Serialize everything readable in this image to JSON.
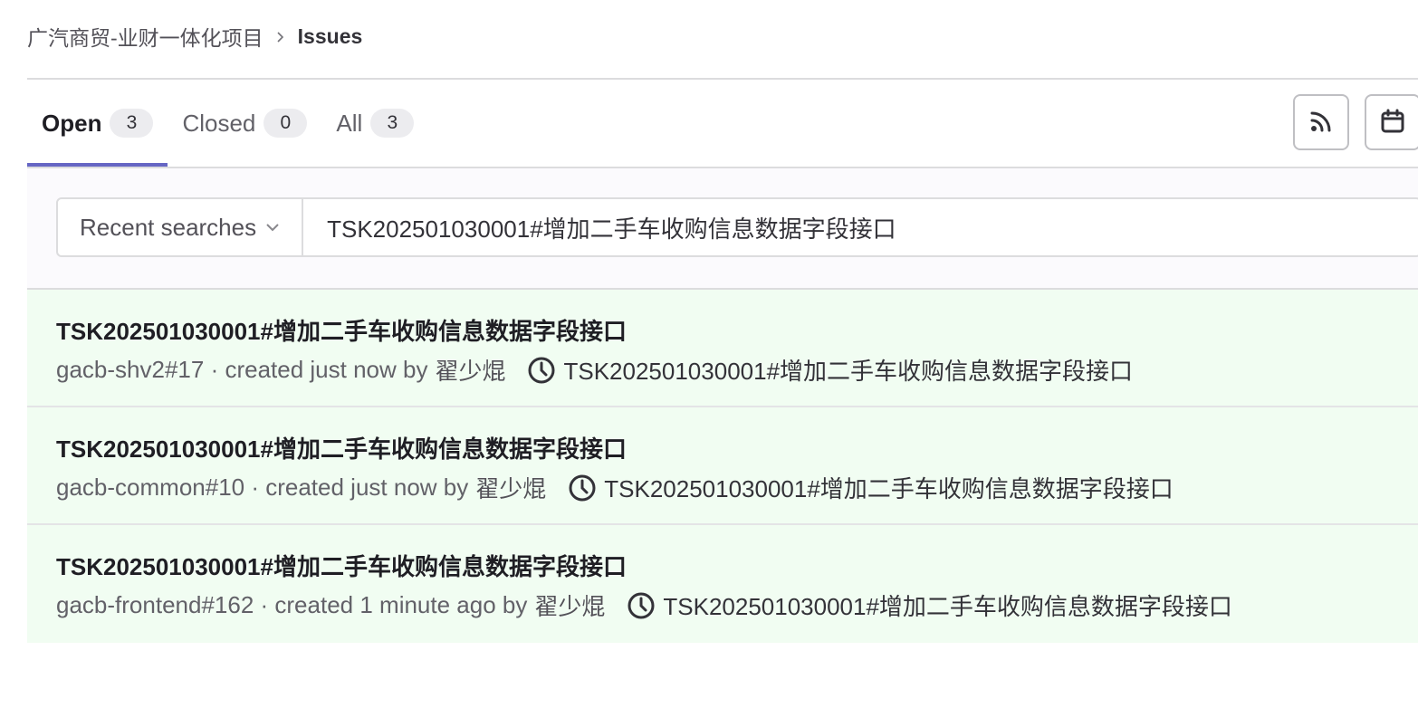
{
  "breadcrumb": {
    "project": "广汽商贸-业财一体化项目",
    "current": "Issues"
  },
  "tabs": [
    {
      "label": "Open",
      "count": "3",
      "active": true
    },
    {
      "label": "Closed",
      "count": "0",
      "active": false
    },
    {
      "label": "All",
      "count": "3",
      "active": false
    }
  ],
  "toolbar": {
    "rss_icon": "rss-icon",
    "calendar_icon": "calendar-icon"
  },
  "filter": {
    "recent_searches_label": "Recent searches",
    "search_value": "TSK202501030001#增加二手车收购信息数据字段接口"
  },
  "issues": [
    {
      "title": "TSK202501030001#增加二手车收购信息数据字段接口",
      "ref": "gacb-shv2#17",
      "created": " · created just now by",
      "author": "翟少焜",
      "milestone": "TSK202501030001#增加二手车收购信息数据字段接口"
    },
    {
      "title": "TSK202501030001#增加二手车收购信息数据字段接口",
      "ref": "gacb-common#10",
      "created": " · created just now by",
      "author": "翟少焜",
      "milestone": "TSK202501030001#增加二手车收购信息数据字段接口"
    },
    {
      "title": "TSK202501030001#增加二手车收购信息数据字段接口",
      "ref": "gacb-frontend#162",
      "created": " · created 1 minute ago by",
      "author": "翟少焜",
      "milestone": "TSK202501030001#增加二手车收购信息数据字段接口"
    }
  ],
  "colors": {
    "active_tab_underline": "#6666c4",
    "issue_row_bg": "#f1fdf2"
  }
}
